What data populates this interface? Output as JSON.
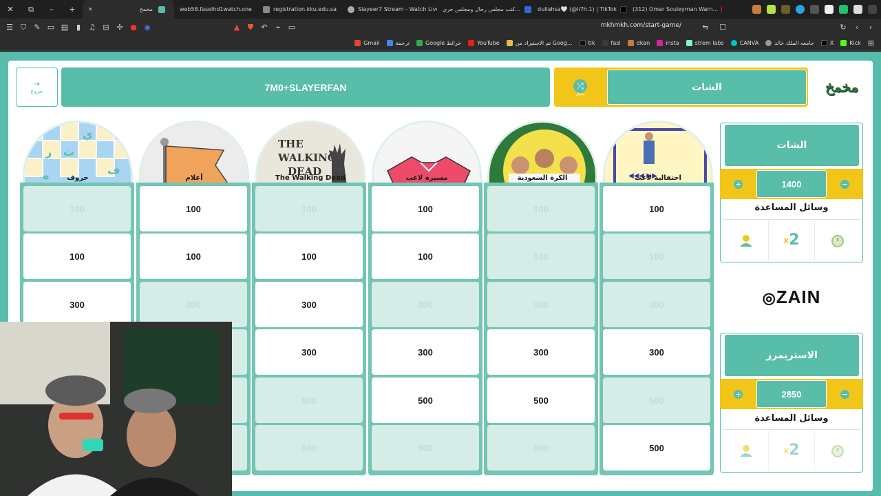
{
  "browser": {
    "tabs": [
      {
        "label": "مخمخ",
        "active": true
      },
      {
        "label": "web58.faselhd1watch.one"
      },
      {
        "label": "registration.kku.edu.sa"
      },
      {
        "label": "Slayeer7 Stream - Watch Live"
      },
      {
        "label": "كتب مجلس رجال ومجلس حري..."
      },
      {
        "label": "dullahsa🤍 (@li7h.1) | TikTok"
      },
      {
        "label": "(312) Omar Souleyman Warn..."
      }
    ],
    "url": "mkhmkh.com/start-game/",
    "bookmarks": [
      "Gmail",
      "ترجمة",
      "Google خرائط",
      "YouTube",
      "تم الاستيراد من Goog...",
      "tik",
      "fasl",
      "dkan",
      "insta",
      "strem labs",
      "CANVA",
      "جامعه الملك خالد",
      "X",
      "Kick"
    ]
  },
  "header": {
    "exit_label": "خروج",
    "team_banner": "7M0+SLAYERFAN",
    "turn_label": "الشات",
    "swap_label": "تبديل"
  },
  "categories": [
    {
      "name": "حروف",
      "theme": "letters"
    },
    {
      "name": "أعلام",
      "theme": "flags"
    },
    {
      "name": "The Walking Dead",
      "theme": "walking-dead"
    },
    {
      "name": "مسيرة لاعب",
      "theme": "jersey"
    },
    {
      "name": "الكرة السعودية",
      "theme": "saudi-football"
    },
    {
      "name": "احتفالية لاعب",
      "theme": "celebration"
    }
  ],
  "board": [
    [
      {
        "v": "100",
        "a": false
      },
      {
        "v": "100",
        "a": true
      },
      {
        "v": "100",
        "a": false
      },
      {
        "v": "100",
        "a": true
      },
      {
        "v": "100",
        "a": false
      },
      {
        "v": "100",
        "a": true
      }
    ],
    [
      {
        "v": "100",
        "a": true
      },
      {
        "v": "100",
        "a": true
      },
      {
        "v": "100",
        "a": true
      },
      {
        "v": "100",
        "a": true
      },
      {
        "v": "100",
        "a": false
      },
      {
        "v": "100",
        "a": false
      }
    ],
    [
      {
        "v": "300",
        "a": true
      },
      {
        "v": "300",
        "a": false
      },
      {
        "v": "300",
        "a": true
      },
      {
        "v": "300",
        "a": false
      },
      {
        "v": "300",
        "a": false
      },
      {
        "v": "300",
        "a": false
      }
    ],
    [
      {
        "v": "",
        "a": false
      },
      {
        "v": "",
        "a": false
      },
      {
        "v": "300",
        "a": true
      },
      {
        "v": "300",
        "a": true
      },
      {
        "v": "300",
        "a": true
      },
      {
        "v": "300",
        "a": true
      }
    ],
    [
      {
        "v": "",
        "a": false
      },
      {
        "v": "",
        "a": false
      },
      {
        "v": "500",
        "a": false
      },
      {
        "v": "500",
        "a": true
      },
      {
        "v": "500",
        "a": true
      },
      {
        "v": "500",
        "a": false
      }
    ],
    [
      {
        "v": "",
        "a": false
      },
      {
        "v": "",
        "a": false
      },
      {
        "v": "500",
        "a": false
      },
      {
        "v": "500",
        "a": false
      },
      {
        "v": "500",
        "a": false
      },
      {
        "v": "500",
        "a": true
      }
    ]
  ],
  "teams": [
    {
      "name": "الشات",
      "score": "1400",
      "help_title": "وسائل المساعدة",
      "help_icons": [
        "timer-icon",
        "double-icon",
        "call-friend-icon"
      ]
    },
    {
      "name": "الاستريمرز",
      "score": "2850",
      "help_title": "وسائل المساعدة",
      "help_icons": [
        "timer-icon",
        "double-icon",
        "call-friend-icon"
      ]
    }
  ],
  "sponsor": "ZAIN",
  "colors": {
    "teal": "#58bda9",
    "yellow": "#f2c618",
    "cell_off": "#d6ece7"
  }
}
